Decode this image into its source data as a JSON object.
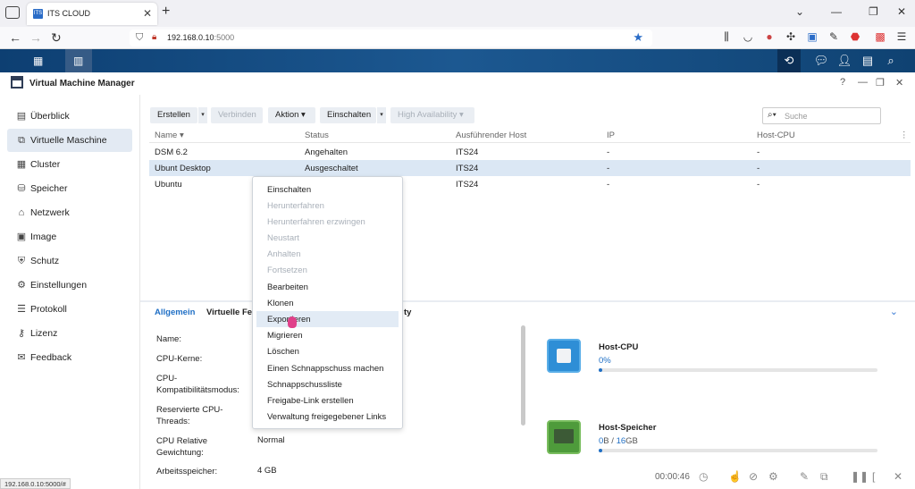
{
  "browser": {
    "tab_title": "ITS CLOUD",
    "favicon_text": "ITS",
    "url_host": "192.168.0.10",
    "url_port": ":5000",
    "status_url": "192.168.0.10:5000/#"
  },
  "app": {
    "title": "Virtual Machine Manager"
  },
  "sidebar": {
    "items": [
      {
        "label": "Überblick",
        "icon": "overview-icon"
      },
      {
        "label": "Virtuelle Maschine",
        "icon": "vm-icon"
      },
      {
        "label": "Cluster",
        "icon": "cluster-icon"
      },
      {
        "label": "Speicher",
        "icon": "storage-icon"
      },
      {
        "label": "Netzwerk",
        "icon": "network-icon"
      },
      {
        "label": "Image",
        "icon": "image-icon"
      },
      {
        "label": "Schutz",
        "icon": "shield-icon"
      },
      {
        "label": "Einstellungen",
        "icon": "gear-icon"
      },
      {
        "label": "Protokoll",
        "icon": "log-icon"
      },
      {
        "label": "Lizenz",
        "icon": "key-icon"
      },
      {
        "label": "Feedback",
        "icon": "mail-icon"
      }
    ]
  },
  "toolbar": {
    "create": "Erstellen",
    "connect": "Verbinden",
    "action": "Aktion ▾",
    "power_on": "Einschalten",
    "high_availability": "High Availability ▾",
    "search_placeholder": "Suche"
  },
  "grid": {
    "columns": [
      "Name ▾",
      "Status",
      "Ausführender Host",
      "IP",
      "Host-CPU"
    ],
    "rows": [
      {
        "name": "DSM 6.2",
        "status": "Angehalten",
        "host": "ITS24",
        "ip": "-",
        "cpu": "-"
      },
      {
        "name": "Ubunt Desktop",
        "status": "Ausgeschaltet",
        "host": "ITS24",
        "ip": "-",
        "cpu": "-"
      },
      {
        "name": "Ubuntu",
        "status": "",
        "host": "ITS24",
        "ip": "-",
        "cpu": "-"
      }
    ]
  },
  "context_menu": {
    "items": [
      {
        "label": "Einschalten",
        "enabled": true
      },
      {
        "label": "Herunterfahren",
        "enabled": false
      },
      {
        "label": "Herunterfahren erzwingen",
        "enabled": false
      },
      {
        "label": "Neustart",
        "enabled": false
      },
      {
        "label": "Anhalten",
        "enabled": false
      },
      {
        "label": "Fortsetzen",
        "enabled": false
      },
      {
        "label": "Bearbeiten",
        "enabled": true
      },
      {
        "label": "Klonen",
        "enabled": true
      },
      {
        "label": "Exportieren",
        "enabled": true
      },
      {
        "label": "Migrieren",
        "enabled": true
      },
      {
        "label": "Löschen",
        "enabled": true
      },
      {
        "label": "Einen Schnappschuss machen",
        "enabled": true
      },
      {
        "label": "Schnappschussliste",
        "enabled": true
      },
      {
        "label": "Freigabe-Link erstellen",
        "enabled": true
      },
      {
        "label": "Verwaltung freigegebener Links",
        "enabled": true
      }
    ]
  },
  "detail": {
    "tabs": {
      "general": "Allgemein",
      "virtual": "Virtuelle Fe",
      "third": "ty"
    },
    "labels": {
      "name": "Name:",
      "cores": "CPU-Kerne:",
      "compat": "CPU-\nKompatibilitätsmodus:",
      "reserved": "Reservierte CPU-\nThreads:",
      "relative": "CPU Relative\nGewichtung:",
      "memory": "Arbeitsspeicher:"
    },
    "values": {
      "relative": "Normal",
      "memory": "4 GB"
    }
  },
  "resources": {
    "cpu": {
      "title": "Host-CPU",
      "value": "0",
      "unit": "%",
      "usage_pct": 0
    },
    "memory": {
      "title": "Host-Speicher",
      "used": "0",
      "used_unit": "B",
      "sep": " / ",
      "total": "16",
      "total_unit": "GB",
      "usage_pct": 0
    }
  },
  "overlay": {
    "time": "00:00:46"
  }
}
